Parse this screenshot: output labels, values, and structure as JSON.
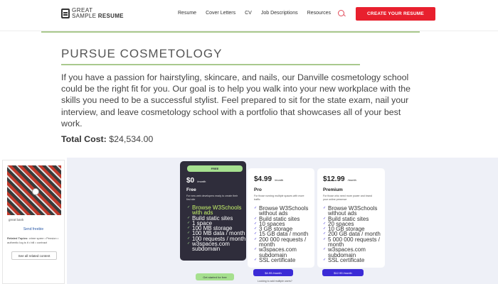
{
  "header": {
    "logo_line1": "GREAT",
    "logo_line2a": "SAMPLE ",
    "logo_line2b": "RESUME",
    "nav": [
      "Resume",
      "Cover Letters",
      "CV",
      "Job Descriptions",
      "Resources"
    ],
    "cta": "CREATE YOUR RESUME"
  },
  "main": {
    "title": "PURSUE COSMETOLOGY",
    "paragraph": "If you have a passion for hairstyling, skincare, and nails, our Danville cosmetology school could be the right fit for you. Our goal is to help you walk into your new workplace with the skills you need to be a successful stylist. Feel prepared to sit for the state exam, nail your interview, and leave cosmetology school with a portfolio that showcases all of your best work.",
    "cost_label": "Total Cost:",
    "cost_value": " $24,534.00"
  },
  "ad": {
    "caption": "great bank",
    "link": "Send freebie",
    "related_label": "Related Topics:",
    "related_text": " crime spree • Pension • authentic log is it • bill • contract",
    "button": "See all related content"
  },
  "plans": [
    {
      "badge": "FREE",
      "price": "$0",
      "period": "/month",
      "name": "Free",
      "desc": "For new web developers ready to create their first site",
      "features": [
        "Browse W3Schools with ads",
        "Build static sites",
        "1 space",
        "100 MB storage",
        "100 MB data / month",
        "100 requests / month",
        "w3spaces.com subdomain"
      ],
      "button": "Get started for free"
    },
    {
      "price": "$4.99",
      "period": "/month",
      "name": "Pro",
      "desc": "For those running multiple spaces with more traffic",
      "features": [
        "Browse W3Schools without ads",
        "Build static sites",
        "10 spaces",
        "3 GB storage",
        "15 GB data / month",
        "200 000 requests / month",
        "w3spaces.com subdomain",
        "SSL certificate"
      ],
      "button": "$4.99 /month",
      "footnote": "Looking to add multiple users?"
    },
    {
      "price": "$12.99",
      "period": "/month",
      "name": "Premium",
      "desc": "For those who need more power and brand your online presence",
      "features": [
        "Browse W3Schools without ads",
        "Build static sites",
        "20 spaces",
        "10 GB storage",
        "200 GB data / month",
        "5 000 000 requests / month",
        "w3spaces.com subdomain",
        "SSL certificate"
      ],
      "button": "$12.99 /month"
    }
  ],
  "colors": {
    "brand_red": "#e8202e",
    "accent_green": "#a9c98d",
    "plan_dark": "#2f2d3b",
    "plan_blue": "#3b2bd6"
  }
}
